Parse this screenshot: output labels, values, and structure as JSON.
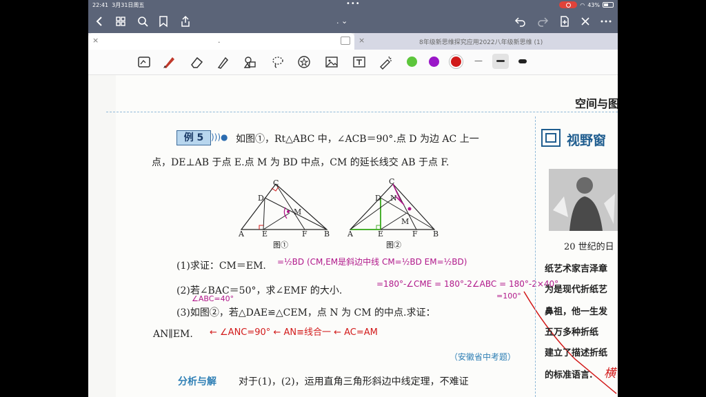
{
  "status_bar": {
    "time": "22:41",
    "date": "3月31日周五",
    "center_dots": "•••",
    "battery": "43%"
  },
  "nav": {
    "title": ". ⌄"
  },
  "tabs": [
    {
      "label": ".",
      "close": "×"
    },
    {
      "label": "8年级新思维探究应用2022八年级新思维 (1)",
      "close": "×"
    }
  ],
  "toolbar": {
    "tools": [
      "lasso-image-icon",
      "pen-icon",
      "eraser-icon",
      "highlighter-icon",
      "shapes-icon",
      "lasso-icon",
      "sticker-icon",
      "image-icon",
      "text-icon",
      "laser-pointer-icon"
    ],
    "colors": [
      "#5dc63c",
      "#9a17c8",
      "#d01a1a"
    ],
    "stroke_thin": "—"
  },
  "page": {
    "section_header": "空间与图",
    "example": {
      "badge": "例 5",
      "line1": "如图①，Rt△ABC 中，∠ACB＝90°.点 D 为边 AC 上一",
      "line2": "点，DE⊥AB 于点 E.点 M 为 BD 中点，CM 的延长线交 AB 于点 F.",
      "fig1_caption": "图①",
      "fig2_caption": "图②",
      "q1": "(1)求证：CM＝EM.",
      "q2": "(2)若∠BAC＝50°，求∠EMF 的大小.",
      "q3": "(3)如图②，若△DAE≌△CEM，点 N 为 CM 的中点.求证：",
      "q3b": "AN∥EM.",
      "source": "（安徽省中考题）",
      "analysis_label": "分析与解",
      "analysis_text": "对于(1)，(2)，运用直角三角形斜边中线定理，不难证"
    },
    "handwriting": {
      "q1_note": "=½BD (CM,EM是斜边中线  CM=½BD  EM=½BD)",
      "q2_note": "=180°-∠CME = 180°-2∠ABC = 180°-2×40°",
      "q2_note2": "=100°",
      "q2_abc": "∠ABC=40°",
      "q3_note": "← ∠ANC=90° ← AN≡线合一 ← AC=AM"
    },
    "sidebar": {
      "title": "视野窗",
      "line1": "20 世纪的日",
      "line2": "纸艺术家吉泽章",
      "line3": "为是现代折纸艺",
      "line4": "鼻祖，他一生发",
      "line5": "五万多种折纸",
      "line6": "建立了描述折纸",
      "line7": "的标准语言.",
      "hw_mark": "横"
    }
  }
}
